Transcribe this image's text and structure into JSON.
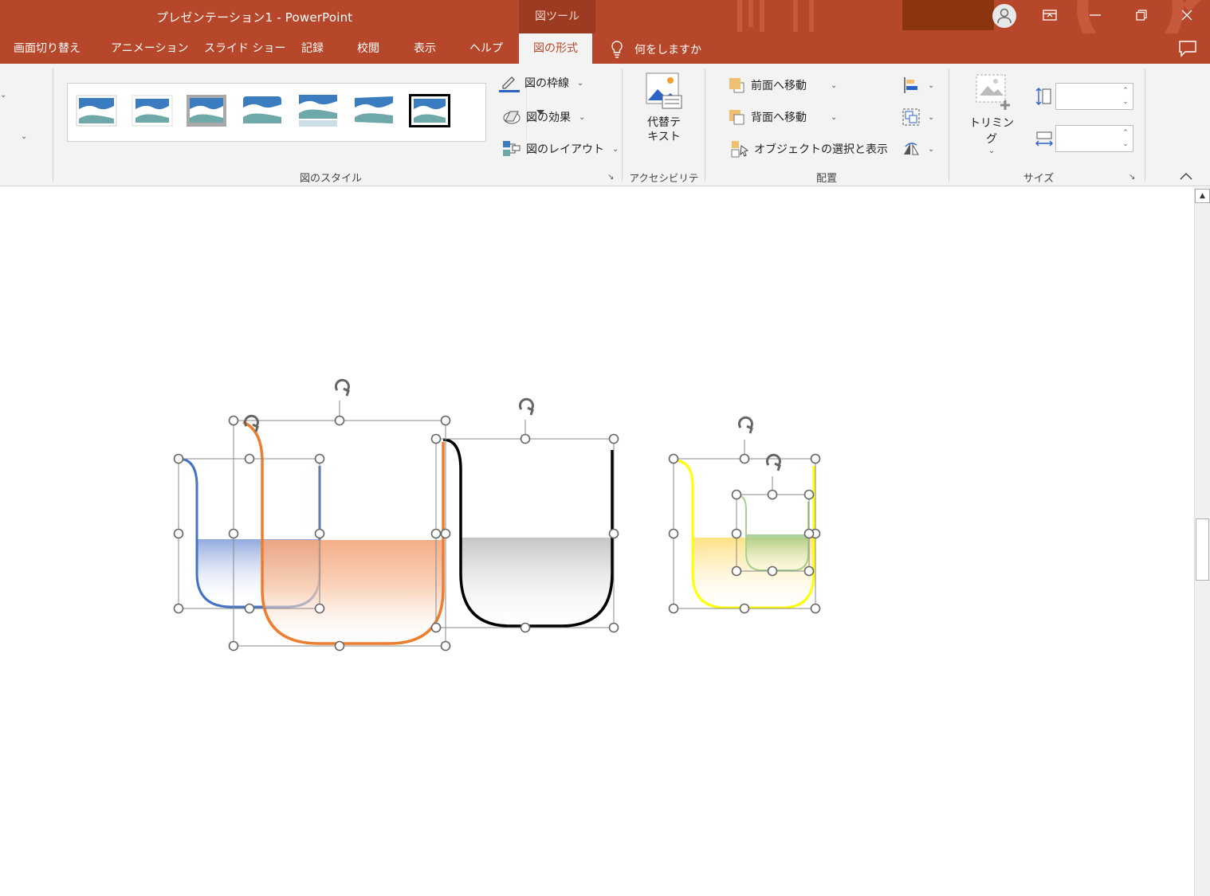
{
  "titlebar": {
    "app_title": "プレゼンテーション1  -  PowerPoint",
    "tool_context": "図ツール"
  },
  "tabs": [
    {
      "label": "画面切り替え",
      "active": false
    },
    {
      "label": "アニメーション",
      "active": false
    },
    {
      "label": "スライド ショー",
      "active": false
    },
    {
      "label": "記録",
      "active": false
    },
    {
      "label": "校閲",
      "active": false
    },
    {
      "label": "表示",
      "active": false
    },
    {
      "label": "ヘルプ",
      "active": false
    },
    {
      "label": "図の形式",
      "active": true
    }
  ],
  "tell_me": "何をしますか",
  "ribbon": {
    "picture_styles": {
      "group_label": "図のスタイル",
      "border_label": "図の枠線",
      "effects_label": "図の効果",
      "layout_label": "図のレイアウト"
    },
    "accessibility": {
      "group_label": "アクセシビリティ",
      "alt_text_line1": "代替テ",
      "alt_text_line2": "キスト"
    },
    "arrange": {
      "group_label": "配置",
      "bring_forward": "前面へ移動",
      "send_backward": "背面へ移動",
      "selection_pane": "オブジェクトの選択と表示"
    },
    "size": {
      "group_label": "サイズ",
      "crop_label": "トリミング",
      "height_value": "",
      "width_value": ""
    }
  },
  "colors": {
    "accent": "#b7472a",
    "shape_blue": "#4472c4",
    "shape_orange": "#ed7d31",
    "shape_black": "#000000",
    "shape_yellow": "#ffff00",
    "shape_green": "#a9d18e"
  }
}
